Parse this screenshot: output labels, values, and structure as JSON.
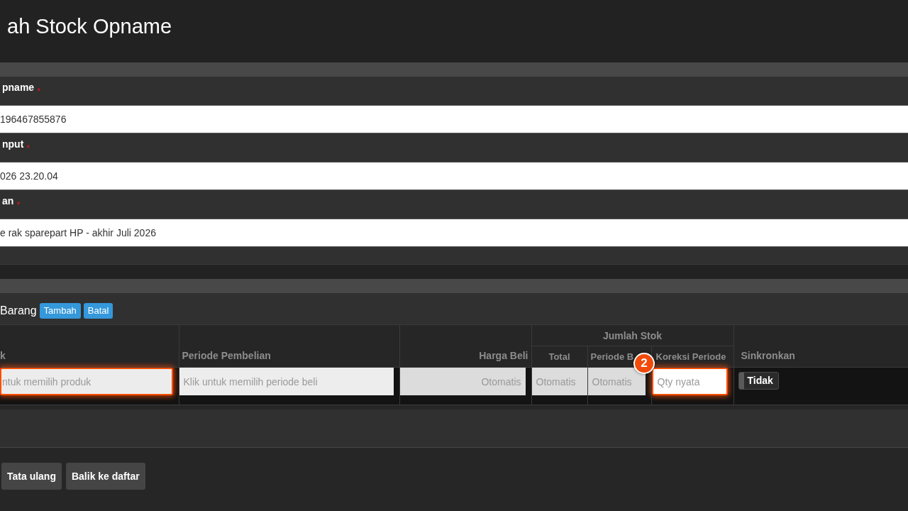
{
  "page_title": "ah Stock Opname",
  "form": {
    "fields": [
      {
        "label": "pname",
        "required_mark": "*",
        "value": "196467855876"
      },
      {
        "label": "nput",
        "required_mark": "*",
        "value": "026 23.20.04"
      },
      {
        "label": "an",
        "required_mark": "*",
        "value": "e rak sparepart HP - akhir Juli 2026"
      }
    ]
  },
  "items": {
    "title": "Barang",
    "buttons": [
      {
        "label": "Tambah"
      },
      {
        "label": "Batal"
      }
    ],
    "table": {
      "columns": [
        {
          "label": "k"
        },
        {
          "label": "Periode Pembelian"
        },
        {
          "label": "Harga Beli"
        },
        {
          "label": "Jumlah Stok",
          "children": [
            {
              "label": "Total"
            },
            {
              "label": "Periode B"
            },
            {
              "label": "Koreksi Periode"
            }
          ]
        },
        {
          "label": "Sinkronkan"
        }
      ],
      "row": [
        {
          "kind": "input",
          "placeholder": "ntuk memilih produk",
          "disabled": false,
          "highlighted": true
        },
        {
          "kind": "input",
          "placeholder": "Klik untuk memilih periode beli",
          "disabled": false,
          "highlighted": false
        },
        {
          "kind": "input",
          "placeholder": "Otomatis",
          "disabled": true,
          "highlighted": false
        },
        {
          "kind": "input",
          "placeholder": "Otomatis",
          "disabled": true,
          "highlighted": false
        },
        {
          "kind": "input",
          "placeholder": "Otomatis",
          "disabled": true,
          "highlighted": false
        },
        {
          "kind": "input",
          "placeholder": "Qty nyata",
          "disabled": false,
          "highlighted": true
        },
        {
          "kind": "toggle",
          "label": "Tidak",
          "on": false
        }
      ]
    }
  },
  "step_badge": "2",
  "footer_buttons": [
    {
      "label": "Tata ulang"
    },
    {
      "label": "Balik ke daftar"
    }
  ]
}
